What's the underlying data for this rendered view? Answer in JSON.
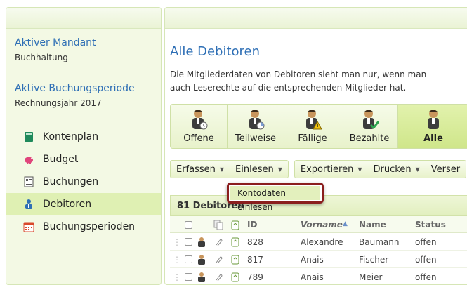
{
  "sidebar": {
    "active_client_label": "Aktiver Mandant",
    "active_client_value": "Buchhaltung",
    "active_period_label": "Aktive Buchungsperiode",
    "active_period_value": "Rechnungsjahr 2017",
    "items": [
      {
        "label": "Kontenplan",
        "icon": "book-icon"
      },
      {
        "label": "Budget",
        "icon": "piggy-bank-icon"
      },
      {
        "label": "Buchungen",
        "icon": "ledger-icon"
      },
      {
        "label": "Debitoren",
        "icon": "people-icon",
        "active": true
      },
      {
        "label": "Buchungsperioden",
        "icon": "calendar-icon"
      }
    ]
  },
  "main": {
    "title": "Alle Debitoren",
    "description": "Die Mitgliederdaten von Debitoren sieht man nur, wenn man auch Leserechte auf die entsprechenden Mitglieder hat.",
    "filters": [
      "Offene",
      "Teilweise",
      "Fällige",
      "Bezahlte",
      "Alle"
    ],
    "toolbar": {
      "erfassen": "Erfassen",
      "einlesen": "Einlesen",
      "exportieren": "Exportieren",
      "drucken": "Drucken",
      "versenden": "Verser"
    },
    "dropdown_item": "Kontodaten einlesen",
    "grid_title": "81 Debitoren",
    "columns": {
      "id": "ID",
      "vorname": "Vorname",
      "name": "Name",
      "status": "Status"
    },
    "rows": [
      {
        "id": "828",
        "vorname": "Alexandre",
        "name": "Baumann",
        "status": "offen"
      },
      {
        "id": "817",
        "vorname": "Anais",
        "name": "Fischer",
        "status": "offen"
      },
      {
        "id": "789",
        "vorname": "Anais",
        "name": "Meier",
        "status": "offen"
      }
    ]
  },
  "colors": {
    "accent": "#2e6fb5",
    "active_green": "#dff0b3",
    "highlight_border": "#8b1e1e"
  }
}
